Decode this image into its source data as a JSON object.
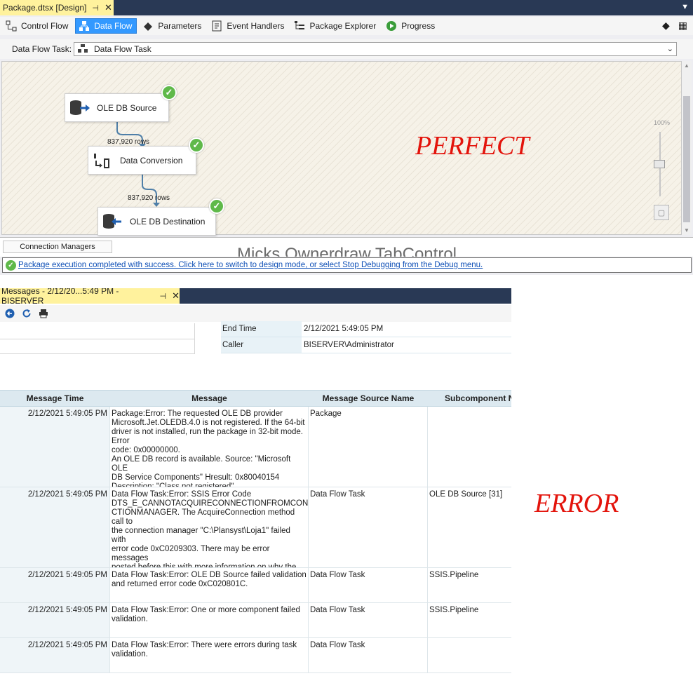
{
  "package_window": {
    "doc_tab_title": "Package.dtsx [Design]",
    "pin_glyph": "⊣",
    "close_glyph": "✕",
    "designer_tabs": [
      {
        "label": "Control Flow",
        "icon": "control-flow-icon",
        "active": false
      },
      {
        "label": "Data Flow",
        "icon": "data-flow-icon",
        "active": true
      },
      {
        "label": "Parameters",
        "icon": "parameters-icon",
        "active": false
      },
      {
        "label": "Event Handlers",
        "icon": "event-handlers-icon",
        "active": false
      },
      {
        "label": "Package Explorer",
        "icon": "package-explorer-icon",
        "active": false
      },
      {
        "label": "Progress",
        "icon": "progress-icon",
        "active": false
      }
    ],
    "data_flow_task_label": "Data Flow Task:",
    "data_flow_task_value": "Data Flow Task",
    "nodes": {
      "source": {
        "label": "OLE DB Source",
        "status": "success"
      },
      "conversion": {
        "label": "Data Conversion",
        "status": "success"
      },
      "destination": {
        "label": "OLE DB Destination",
        "status": "success"
      }
    },
    "path_rows": [
      "837,920 rows",
      "837,920 rows"
    ],
    "zoom_label": "100%",
    "annotation": "PERFECT",
    "connection_managers_tab": "Connection Managers",
    "owner_draw_text": "Micks Ownerdraw TabControl",
    "status_message": "Package execution completed with success. Click here to switch to design mode, or select Stop Debugging from the Debug menu.",
    "colors": {
      "active_tab": "#3399ff",
      "doc_tab": "#fff29d",
      "tab_strip": "#293955",
      "success_green": "#5fb94a",
      "annotation_red": "#e3140c",
      "link_blue": "#0e4fb6"
    }
  },
  "messages_window": {
    "tab_title": "Messages - 2/12/20...5:49 PM - BISERVER",
    "toolbar": [
      {
        "icon": "back-icon"
      },
      {
        "icon": "refresh-icon"
      },
      {
        "icon": "print-icon"
      }
    ],
    "properties": [
      {
        "name": "End Time",
        "value": "2/12/2021 5:49:05 PM"
      },
      {
        "name": "Caller",
        "value": "BISERVER\\Administrator"
      }
    ],
    "columns": [
      "Message Time",
      "Message",
      "Message Source Name",
      "Subcomponent Name"
    ],
    "rows": [
      {
        "time": "2/12/2021 5:49:05 PM",
        "message": "Package:Error: The requested OLE DB provider\nMicrosoft.Jet.OLEDB.4.0 is not registered. If the 64-bit\ndriver is not installed, run the package in 32-bit mode. Error\ncode: 0x00000000.\nAn OLE DB record is available.  Source: \"Microsoft OLE\nDB Service Components\"  Hresult: 0x80040154\nDescription: \"Class not registered\".",
        "source": "Package",
        "subcomponent": ""
      },
      {
        "time": "2/12/2021 5:49:05 PM",
        "message": "Data Flow Task:Error: SSIS Error Code\nDTS_E_CANNOTACQUIRECONNECTIONFROMCONNE\nCTIONMANAGER.  The AcquireConnection method call to\nthe connection manager \"C:\\Plansyst\\Loja1\" failed with\nerror code 0xC0209303.  There may be error messages\nposted before this with more information on why the\nAcquireConnection method call failed.",
        "source": "Data Flow Task",
        "subcomponent": "OLE DB Source [31]"
      },
      {
        "time": "2/12/2021 5:49:05 PM",
        "message": "Data Flow Task:Error: OLE DB Source failed validation\nand returned error code 0xC020801C.",
        "source": "Data Flow Task",
        "subcomponent": "SSIS.Pipeline"
      },
      {
        "time": "2/12/2021 5:49:05 PM",
        "message": "Data Flow Task:Error: One or more component failed\nvalidation.",
        "source": "Data Flow Task",
        "subcomponent": "SSIS.Pipeline"
      },
      {
        "time": "2/12/2021 5:49:05 PM",
        "message": "Data Flow Task:Error: There were errors during task\nvalidation.",
        "source": "Data Flow Task",
        "subcomponent": ""
      }
    ]
  },
  "error_annotation": "ERROR"
}
